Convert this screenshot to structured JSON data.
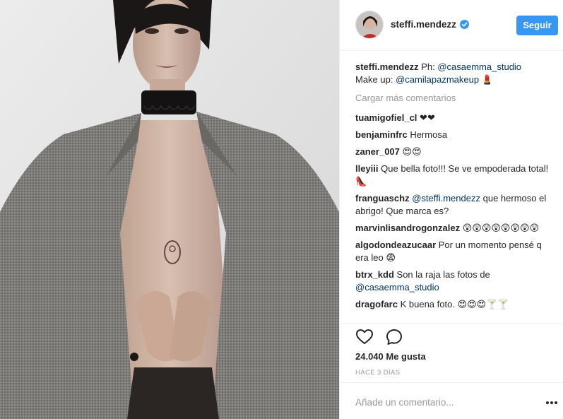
{
  "header": {
    "username": "steffi.mendezz",
    "follow_label": "Seguir"
  },
  "caption": {
    "user": "steffi.mendezz",
    "text_1": "Ph:",
    "mention_1": "@casaemma_studio",
    "text_2": "Make up:",
    "mention_2": "@camilapazmakeup",
    "emoji": "💄"
  },
  "load_more_label": "Cargar más comentarios",
  "comments": [
    {
      "user": "tuamigofiel_cl",
      "text": "❤❤"
    },
    {
      "user": "benjaminfrc",
      "text": "Hermosa"
    },
    {
      "user": "zaner_007",
      "text": "😍😍"
    },
    {
      "user": "lleyiii",
      "text": "Que bella foto!!! Se ve empoderada total! 👠"
    },
    {
      "user": "franguaschz",
      "mention": "@steffi.mendezz",
      "text": "que hermoso el abrigo! Que marca es?"
    },
    {
      "user": "marvinlisandrogonzalez",
      "text": "😲😲😲😲😲😲😲😲"
    },
    {
      "user": "algodondeazucaar",
      "text": "Por un momento pensé q era leo 😨"
    },
    {
      "user": "btrx_kdd",
      "text": "Son la raja las fotos de",
      "mention": "@casaemma_studio"
    },
    {
      "user": "dragofarc",
      "text": "K buena foto. 😍😍😍🍸🍸"
    }
  ],
  "likes_label": "24.040 Me gusta",
  "time_label": "HACE 3 DÍAS",
  "add_comment_placeholder": "Añade un comentario...",
  "colors": {
    "accent": "#3897f0",
    "mention": "#003569",
    "muted": "#999999",
    "text": "#262626",
    "verified": "#3897f0"
  },
  "icons": {
    "like": "heart-outline-icon",
    "comment": "speech-bubble-icon",
    "verified": "verified-badge-icon",
    "more": "ellipsis-icon"
  }
}
